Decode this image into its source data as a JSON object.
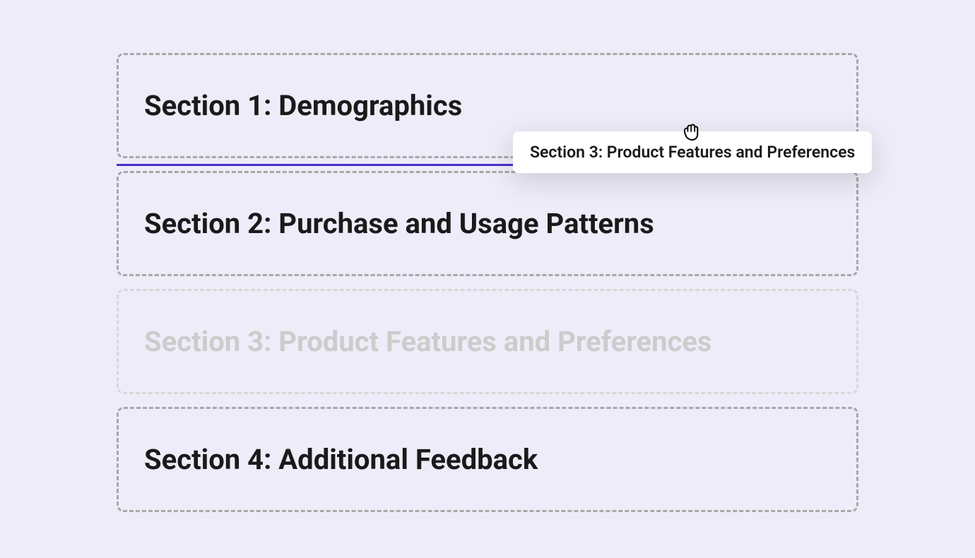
{
  "sections": [
    {
      "title": "Section 1: Demographics"
    },
    {
      "title": "Section 2: Purchase and Usage Patterns"
    },
    {
      "title": "Section 3: Product Features and Preferences"
    },
    {
      "title": "Section 4: Additional Feedback"
    }
  ],
  "dragging": {
    "label": "Section 3: Product Features and Preferences"
  }
}
